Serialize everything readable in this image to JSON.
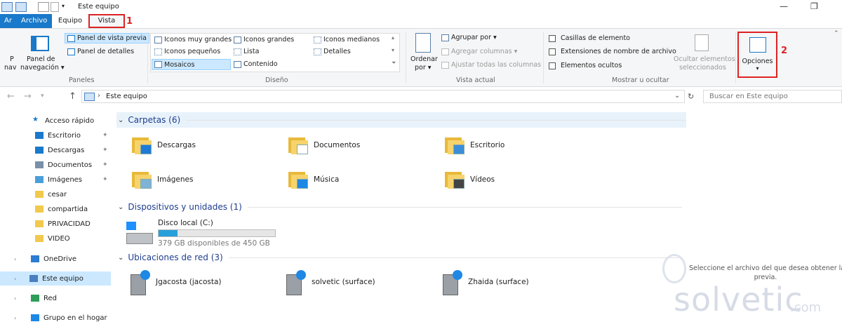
{
  "window": {
    "title": "Este equipo"
  },
  "tabs": {
    "archivo_prefix": "Ar",
    "archivo": "Archivo",
    "equipo": "Equipo",
    "vista": "Vista",
    "mark1": "1"
  },
  "ribbon": {
    "paneles": {
      "nav_short": "P",
      "nav_short2": "nav",
      "nav_label1": "Panel de",
      "nav_label2": "navegación",
      "vista_previa": "Panel de vista previa",
      "detalles": "Panel de detalles",
      "group": "Paneles"
    },
    "diseno": {
      "items": [
        "Iconos muy grandes",
        "Iconos grandes",
        "Iconos medianos",
        "Iconos pequeños",
        "Lista",
        "Detalles",
        "Mosaicos",
        "Contenido"
      ],
      "group": "Diseño"
    },
    "vista_actual": {
      "ordenar1": "Ordenar",
      "ordenar2": "por",
      "agrupar": "Agrupar por",
      "agregar_columnas": "Agregar columnas",
      "ajustar": "Ajustar todas las columnas",
      "group": "Vista actual"
    },
    "mostrar": {
      "casillas": "Casillas de elemento",
      "extensiones": "Extensiones de nombre de archivo",
      "ocultos": "Elementos ocultos",
      "ocultar1": "Ocultar elementos",
      "ocultar2": "seleccionados",
      "group": "Mostrar u ocultar"
    },
    "opciones": "Opciones",
    "mark2": "2"
  },
  "address": {
    "path": "Este equipo",
    "search_placeholder": "Buscar en Este equipo"
  },
  "sidebar": [
    {
      "label": "Acceso rápido",
      "pinned": false
    },
    {
      "label": "Escritorio",
      "pinned": true
    },
    {
      "label": "Descargas",
      "pinned": true
    },
    {
      "label": "Documentos",
      "pinned": true
    },
    {
      "label": "Imágenes",
      "pinned": true
    },
    {
      "label": "cesar",
      "pinned": false
    },
    {
      "label": "compartida",
      "pinned": false
    },
    {
      "label": "PRIVACIDAD",
      "pinned": false
    },
    {
      "label": "VIDEO",
      "pinned": false
    },
    {
      "label": "OneDrive",
      "pinned": false
    },
    {
      "label": "Este equipo",
      "pinned": false,
      "selected": true
    },
    {
      "label": "Red",
      "pinned": false
    },
    {
      "label": "Grupo en el hogar",
      "pinned": false
    }
  ],
  "sections": {
    "carpetas": "Carpetas (6)",
    "dispositivos": "Dispositivos y unidades (1)",
    "red": "Ubicaciones de red (3)"
  },
  "folders": [
    "Descargas",
    "Documentos",
    "Escritorio",
    "Imágenes",
    "Música",
    "Vídeos"
  ],
  "drive": {
    "name": "Disco local (C:)",
    "free": "379 GB disponibles de 450 GB",
    "used_fraction": 0.16
  },
  "network": [
    "Jgacosta (jacosta)",
    "solvetic (surface)",
    "Zhaida (surface)"
  ],
  "preview": {
    "line1": "Seleccione el archivo del que desea obtener la v",
    "line2": "previa."
  },
  "watermark": {
    "main": "solvetic",
    "suffix": ".com"
  },
  "colors": {
    "accent": "#1979ca",
    "highlight": "#cce8ff",
    "mark": "#d22222"
  }
}
